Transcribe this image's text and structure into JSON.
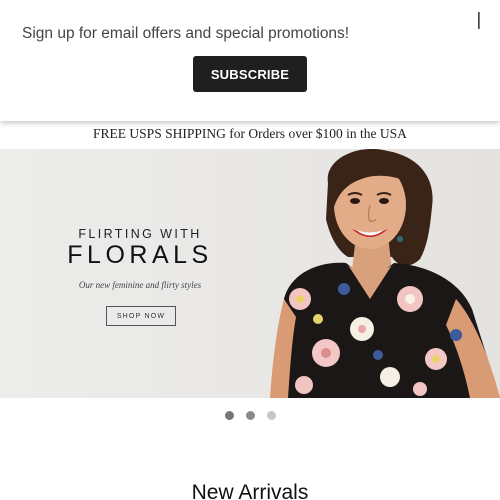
{
  "promo": {
    "text": "Sign up for email offers and special promotions!",
    "close_label": "|",
    "subscribe_label": "SUBSCRIBE"
  },
  "shipping_bar": {
    "text": "FREE USPS SHIPPING for Orders over $100 in the USA"
  },
  "hero": {
    "pre_title": "FLIRTING WITH",
    "title": "FLORALS",
    "subtitle": "Our new feminine and flirty styles",
    "cta_label": "SHOP NOW"
  },
  "carousel": {
    "slide_count": 3
  },
  "section": {
    "title": "New Arrivals"
  },
  "colors": {
    "button_bg": "#1f1f1f",
    "hero_bg": "#ebeae8",
    "lipstick": "#c8252b"
  },
  "icons": {
    "close": "close-icon"
  }
}
